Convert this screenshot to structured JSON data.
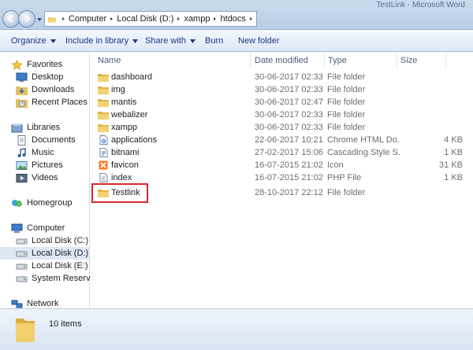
{
  "window": {
    "title": "TestLink - Microsoft Word"
  },
  "address": {
    "crumbs": [
      "Computer",
      "Local Disk (D:)",
      "xampp",
      "htdocs"
    ]
  },
  "toolbar": {
    "organize": "Organize",
    "include_in_library": "Include in library",
    "share_with": "Share with",
    "burn": "Burn",
    "new_folder": "New folder"
  },
  "nav": {
    "favorites": "Favorites",
    "desktop": "Desktop",
    "downloads": "Downloads",
    "recent_places": "Recent Places",
    "libraries": "Libraries",
    "documents": "Documents",
    "music": "Music",
    "pictures": "Pictures",
    "videos": "Videos",
    "homegroup": "Homegroup",
    "computer": "Computer",
    "local_c": "Local Disk (C:)",
    "local_d": "Local Disk (D:)",
    "local_e": "Local Disk (E:)",
    "system_reserved": "System Reserved",
    "network": "Network"
  },
  "columns": {
    "name": "Name",
    "date": "Date modified",
    "type": "Type",
    "size": "Size"
  },
  "files": [
    {
      "name": "dashboard",
      "date": "30-06-2017 02:33",
      "type": "File folder",
      "size": "",
      "icon": "folder-icon"
    },
    {
      "name": "img",
      "date": "30-06-2017 02:33",
      "type": "File folder",
      "size": "",
      "icon": "folder-icon"
    },
    {
      "name": "mantis",
      "date": "30-06-2017 02:47",
      "type": "File folder",
      "size": "",
      "icon": "folder-icon"
    },
    {
      "name": "webalizer",
      "date": "30-06-2017 02:33",
      "type": "File folder",
      "size": "",
      "icon": "folder-icon"
    },
    {
      "name": "xampp",
      "date": "30-06-2017 02:33",
      "type": "File folder",
      "size": "",
      "icon": "folder-icon"
    },
    {
      "name": "applications",
      "date": "22-06-2017 10:21",
      "type": "Chrome HTML Do...",
      "size": "4 KB",
      "icon": "html-file-icon"
    },
    {
      "name": "bitnami",
      "date": "27-02-2017 15:06",
      "type": "Cascading Style S...",
      "size": "1 KB",
      "icon": "css-file-icon"
    },
    {
      "name": "favicon",
      "date": "16-07-2015 21:02",
      "type": "Icon",
      "size": "31 KB",
      "icon": "xampp-icon"
    },
    {
      "name": "index",
      "date": "16-07-2015 21:02",
      "type": "PHP File",
      "size": "1 KB",
      "icon": "php-file-icon"
    },
    {
      "name": "Testlink",
      "date": "28-10-2017 22:12",
      "type": "File folder",
      "size": "",
      "icon": "folder-icon"
    }
  ],
  "status": {
    "count": "10 items"
  }
}
